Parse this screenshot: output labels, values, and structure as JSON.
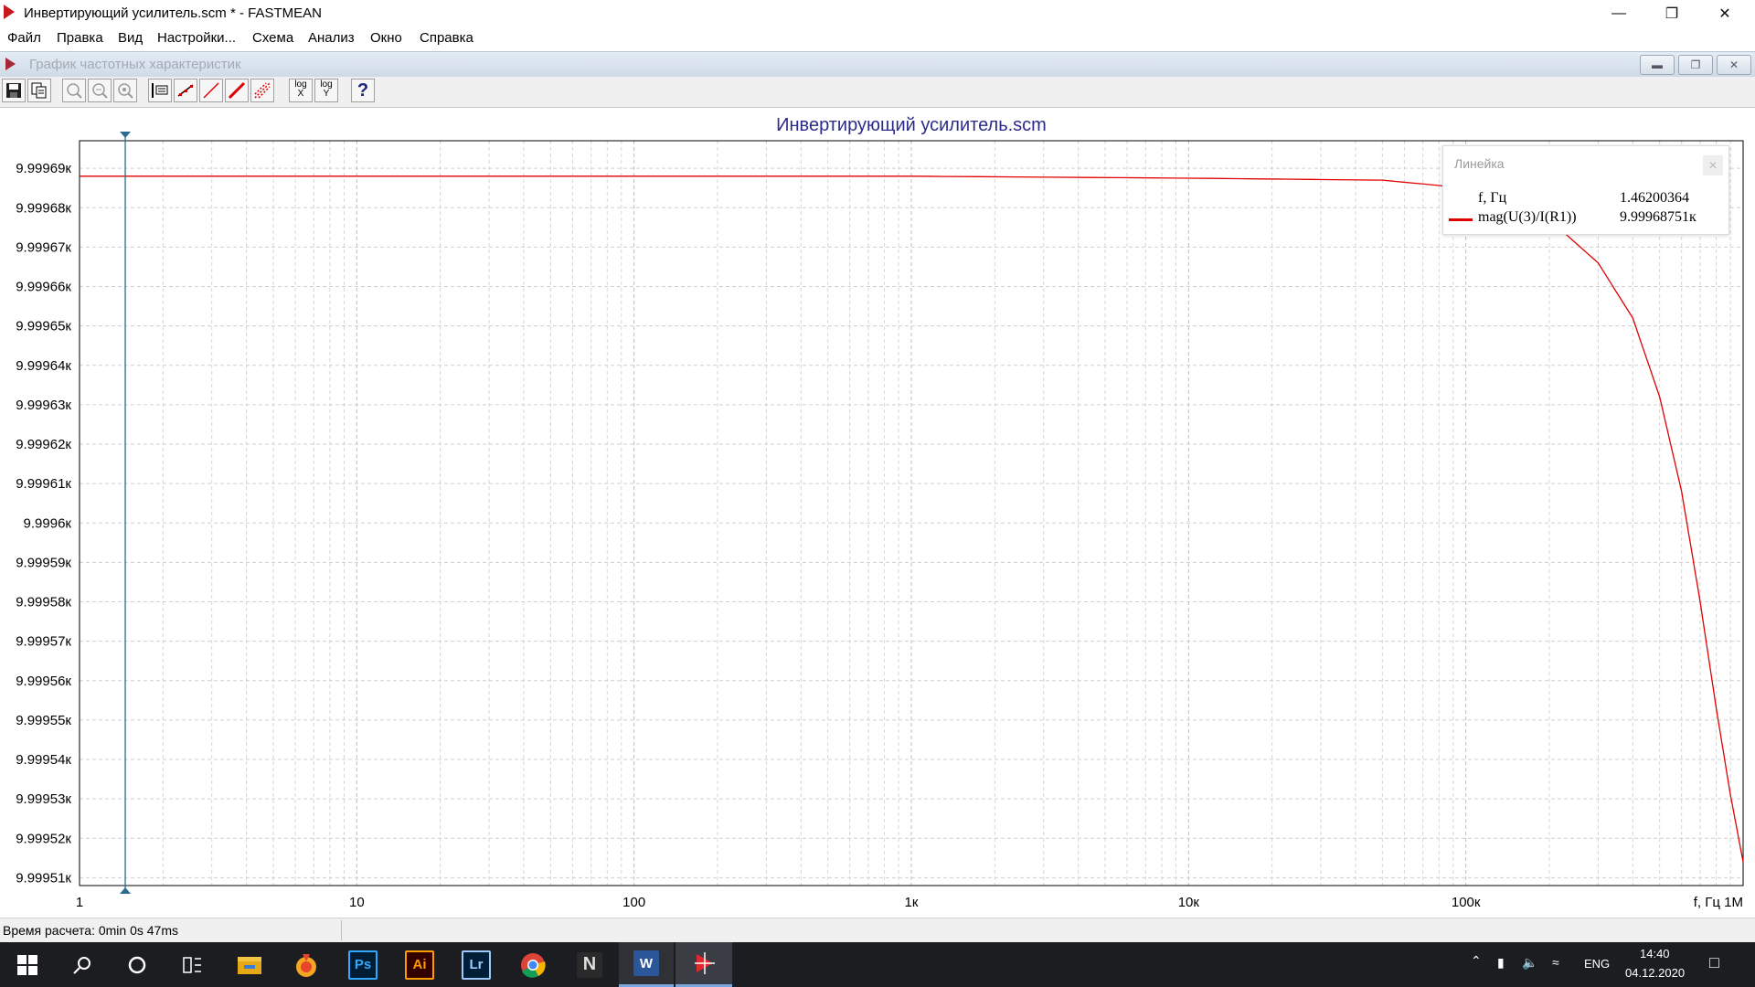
{
  "window": {
    "title": "Инвертирующий усилитель.scm * - FASTMEAN",
    "minimize_icon": "minimize-icon",
    "maximize_icon": "restore-icon",
    "close_icon": "close-icon"
  },
  "menu": [
    {
      "label": "Файл"
    },
    {
      "label": "Правка"
    },
    {
      "label": "Вид"
    },
    {
      "label": "Настройки..."
    },
    {
      "label": "Схема"
    },
    {
      "label": "Анализ"
    },
    {
      "label": "Окно"
    },
    {
      "label": "Справка"
    }
  ],
  "child_window": {
    "title": "График частотных характеристик"
  },
  "toolbar": {
    "buttons": [
      "save-icon",
      "copy-icon",
      "zoom-icon",
      "zoom-in-icon",
      "zoom-out-icon",
      "ruler-icon",
      "marker-line-icon",
      "line-icon",
      "thick-line-icon",
      "grid-icon",
      "log-x-icon",
      "log-y-icon",
      "help-icon"
    ],
    "log_label": "log",
    "log_x_axis": "X",
    "log_y_axis": "Y",
    "help_label": "?"
  },
  "chart_data": {
    "type": "line",
    "title": "Инвертирующий усилитель.scm",
    "x_scale": "log",
    "xlim": [
      1,
      1000000
    ],
    "ylim": [
      9.999508,
      9.999697
    ],
    "x_unit": "Гц",
    "y_unit": "к",
    "xlabel": "f, Гц",
    "xtick_values": [
      1,
      10,
      100,
      1000,
      10000,
      100000
    ],
    "xtick_labels": [
      "1",
      "10",
      "100",
      "1к",
      "10к",
      "100к"
    ],
    "xend_label": "1М",
    "ytick_values": [
      9.99969,
      9.99968,
      9.99967,
      9.99966,
      9.99965,
      9.99964,
      9.99963,
      9.99962,
      9.99961,
      9.9996,
      9.99959,
      9.99958,
      9.99957,
      9.99956,
      9.99955,
      9.99954,
      9.99953,
      9.99952,
      9.99951
    ],
    "ytick_labels": [
      "9.99969к",
      "9.99968к",
      "9.99967к",
      "9.99966к",
      "9.99965к",
      "9.99964к",
      "9.99963к",
      "9.99962к",
      "9.99961к",
      "9.9996к",
      "9.99959к",
      "9.99958к",
      "9.99957к",
      "9.99956к",
      "9.99955к",
      "9.99954к",
      "9.99953к",
      "9.99952к",
      "9.99951к"
    ],
    "grid": true,
    "series": [
      {
        "name": "mag(U(3)/I(R1))",
        "color": "#e00000",
        "x": [
          1,
          10,
          100,
          1000,
          10000,
          50000,
          100000,
          150000,
          200000,
          300000,
          400000,
          500000,
          600000,
          700000,
          800000,
          900000,
          1000000
        ],
        "y": [
          9.999688,
          9.999688,
          9.999688,
          9.999688,
          9.9996875,
          9.999687,
          9.999685,
          9.999682,
          9.999677,
          9.999666,
          9.999652,
          9.999632,
          9.999608,
          9.99958,
          9.999553,
          9.999531,
          9.999514
        ]
      }
    ],
    "cursor": {
      "x": 1.46200364,
      "color": "#2c6a8f"
    }
  },
  "ruler": {
    "title": "Линейка",
    "close_icon": "close-icon",
    "rows": [
      {
        "label": "f, Гц",
        "value": "1.46200364"
      },
      {
        "label": "mag(U(3)/I(R1))",
        "value": "9.99968751к"
      }
    ]
  },
  "status": {
    "text": "Время расчета: 0min 0s 47ms"
  },
  "taskbar": {
    "apps": [
      "windows-start-icon",
      "search-icon",
      "cortana-icon",
      "task-view-icon",
      "file-explorer-icon",
      "yandex-browser-icon",
      "photoshop-icon",
      "illustrator-icon",
      "lightroom-icon",
      "chrome-icon",
      "notion-icon",
      "word-icon",
      "fastmean-icon"
    ],
    "ps": "Ps",
    "ai": "Ai",
    "lr": "Lr",
    "n": "N",
    "w": "W",
    "lang": "ENG",
    "time": "14:40",
    "date": "04.12.2020"
  }
}
